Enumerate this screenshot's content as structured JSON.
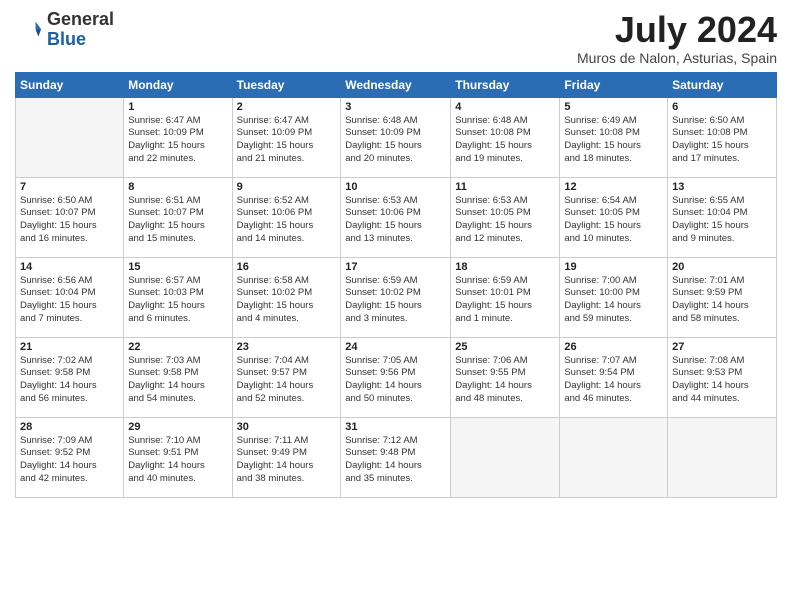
{
  "header": {
    "logo_general": "General",
    "logo_blue": "Blue",
    "month_title": "July 2024",
    "location": "Muros de Nalon, Asturias, Spain"
  },
  "weekdays": [
    "Sunday",
    "Monday",
    "Tuesday",
    "Wednesday",
    "Thursday",
    "Friday",
    "Saturday"
  ],
  "weeks": [
    [
      {
        "day": "",
        "info": ""
      },
      {
        "day": "1",
        "info": "Sunrise: 6:47 AM\nSunset: 10:09 PM\nDaylight: 15 hours\nand 22 minutes."
      },
      {
        "day": "2",
        "info": "Sunrise: 6:47 AM\nSunset: 10:09 PM\nDaylight: 15 hours\nand 21 minutes."
      },
      {
        "day": "3",
        "info": "Sunrise: 6:48 AM\nSunset: 10:09 PM\nDaylight: 15 hours\nand 20 minutes."
      },
      {
        "day": "4",
        "info": "Sunrise: 6:48 AM\nSunset: 10:08 PM\nDaylight: 15 hours\nand 19 minutes."
      },
      {
        "day": "5",
        "info": "Sunrise: 6:49 AM\nSunset: 10:08 PM\nDaylight: 15 hours\nand 18 minutes."
      },
      {
        "day": "6",
        "info": "Sunrise: 6:50 AM\nSunset: 10:08 PM\nDaylight: 15 hours\nand 17 minutes."
      }
    ],
    [
      {
        "day": "7",
        "info": "Sunrise: 6:50 AM\nSunset: 10:07 PM\nDaylight: 15 hours\nand 16 minutes."
      },
      {
        "day": "8",
        "info": "Sunrise: 6:51 AM\nSunset: 10:07 PM\nDaylight: 15 hours\nand 15 minutes."
      },
      {
        "day": "9",
        "info": "Sunrise: 6:52 AM\nSunset: 10:06 PM\nDaylight: 15 hours\nand 14 minutes."
      },
      {
        "day": "10",
        "info": "Sunrise: 6:53 AM\nSunset: 10:06 PM\nDaylight: 15 hours\nand 13 minutes."
      },
      {
        "day": "11",
        "info": "Sunrise: 6:53 AM\nSunset: 10:05 PM\nDaylight: 15 hours\nand 12 minutes."
      },
      {
        "day": "12",
        "info": "Sunrise: 6:54 AM\nSunset: 10:05 PM\nDaylight: 15 hours\nand 10 minutes."
      },
      {
        "day": "13",
        "info": "Sunrise: 6:55 AM\nSunset: 10:04 PM\nDaylight: 15 hours\nand 9 minutes."
      }
    ],
    [
      {
        "day": "14",
        "info": "Sunrise: 6:56 AM\nSunset: 10:04 PM\nDaylight: 15 hours\nand 7 minutes."
      },
      {
        "day": "15",
        "info": "Sunrise: 6:57 AM\nSunset: 10:03 PM\nDaylight: 15 hours\nand 6 minutes."
      },
      {
        "day": "16",
        "info": "Sunrise: 6:58 AM\nSunset: 10:02 PM\nDaylight: 15 hours\nand 4 minutes."
      },
      {
        "day": "17",
        "info": "Sunrise: 6:59 AM\nSunset: 10:02 PM\nDaylight: 15 hours\nand 3 minutes."
      },
      {
        "day": "18",
        "info": "Sunrise: 6:59 AM\nSunset: 10:01 PM\nDaylight: 15 hours\nand 1 minute."
      },
      {
        "day": "19",
        "info": "Sunrise: 7:00 AM\nSunset: 10:00 PM\nDaylight: 14 hours\nand 59 minutes."
      },
      {
        "day": "20",
        "info": "Sunrise: 7:01 AM\nSunset: 9:59 PM\nDaylight: 14 hours\nand 58 minutes."
      }
    ],
    [
      {
        "day": "21",
        "info": "Sunrise: 7:02 AM\nSunset: 9:58 PM\nDaylight: 14 hours\nand 56 minutes."
      },
      {
        "day": "22",
        "info": "Sunrise: 7:03 AM\nSunset: 9:58 PM\nDaylight: 14 hours\nand 54 minutes."
      },
      {
        "day": "23",
        "info": "Sunrise: 7:04 AM\nSunset: 9:57 PM\nDaylight: 14 hours\nand 52 minutes."
      },
      {
        "day": "24",
        "info": "Sunrise: 7:05 AM\nSunset: 9:56 PM\nDaylight: 14 hours\nand 50 minutes."
      },
      {
        "day": "25",
        "info": "Sunrise: 7:06 AM\nSunset: 9:55 PM\nDaylight: 14 hours\nand 48 minutes."
      },
      {
        "day": "26",
        "info": "Sunrise: 7:07 AM\nSunset: 9:54 PM\nDaylight: 14 hours\nand 46 minutes."
      },
      {
        "day": "27",
        "info": "Sunrise: 7:08 AM\nSunset: 9:53 PM\nDaylight: 14 hours\nand 44 minutes."
      }
    ],
    [
      {
        "day": "28",
        "info": "Sunrise: 7:09 AM\nSunset: 9:52 PM\nDaylight: 14 hours\nand 42 minutes."
      },
      {
        "day": "29",
        "info": "Sunrise: 7:10 AM\nSunset: 9:51 PM\nDaylight: 14 hours\nand 40 minutes."
      },
      {
        "day": "30",
        "info": "Sunrise: 7:11 AM\nSunset: 9:49 PM\nDaylight: 14 hours\nand 38 minutes."
      },
      {
        "day": "31",
        "info": "Sunrise: 7:12 AM\nSunset: 9:48 PM\nDaylight: 14 hours\nand 35 minutes."
      },
      {
        "day": "",
        "info": ""
      },
      {
        "day": "",
        "info": ""
      },
      {
        "day": "",
        "info": ""
      }
    ]
  ]
}
